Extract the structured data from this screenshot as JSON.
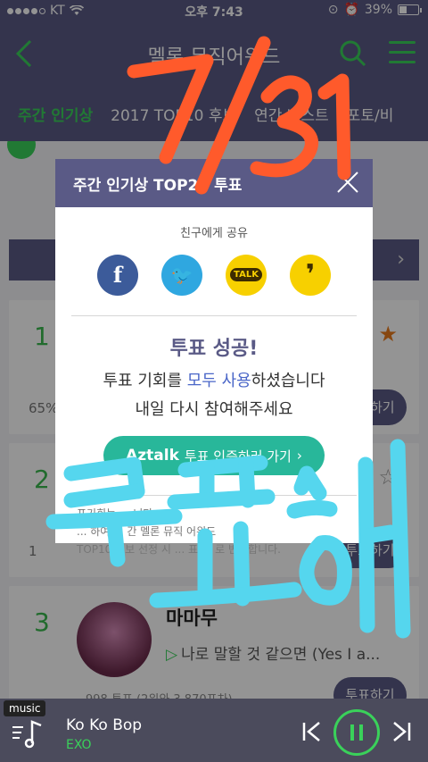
{
  "status": {
    "carrier": "KT",
    "time": "오후 7:43",
    "battery": "39%",
    "battery_level": 0.39
  },
  "header": {
    "title": "멜론 뮤직어워드",
    "back_icon": "chevron-left-icon",
    "search_icon": "search-icon",
    "menu_icon": "hamburger-menu-icon"
  },
  "tabs": [
    {
      "label": "주간 인기상",
      "active": true
    },
    {
      "label": "2017 TOP10 후보",
      "active": false
    },
    {
      "label": "연간 베스트",
      "active": false
    },
    {
      "label": "포토/비",
      "active": false
    }
  ],
  "background": {
    "rows": [
      {
        "rank": "1",
        "pct": "65%",
        "vote_label": "투표하기"
      },
      {
        "rank": "2",
        "pct": "1",
        "vote_label": "투표하기"
      },
      {
        "rank": "3",
        "artist": "마마무",
        "song": "나로 말할 것 같으면 (Yes I a...",
        "votes": "998 투표 (2위와 3,870표차)",
        "vote_label": "투표하기"
      }
    ]
  },
  "modal": {
    "title": "주간 인기상 TOP20 투표",
    "share_label": "친구에게 공유",
    "share_buttons": [
      {
        "name": "facebook",
        "glyph": "f"
      },
      {
        "name": "twitter",
        "glyph": "🐦"
      },
      {
        "name": "kakaotalk",
        "glyph": "TALK"
      },
      {
        "name": "kakaostory",
        "glyph": "❜"
      }
    ],
    "success": "투표 성공!",
    "message_line1_pre": "투표 기회를 ",
    "message_line1_hl": "모두 사용",
    "message_line1_post": "하셨습니다",
    "message_line2": "내일 다시 참여해주세요",
    "aztalk_logo": "Aztalk",
    "aztalk_label": "투표 인증하러 가기",
    "notice_line1": "표기회는 ... 니다.",
    "notice_line2": "... 하여 ... 간 멜론 뮤직 어워드",
    "notice_line3": "TOP10 후보 선정 시 ... 표 ... 로 반영합니다."
  },
  "player": {
    "tag": "music",
    "song": "Ko Ko Bop",
    "artist": "EXO"
  },
  "annotations": {
    "top": "7/31",
    "bottom": "투표해"
  },
  "colors": {
    "header_bg": "#5a5a86",
    "accent_green": "#3ad15a",
    "scribble_orange": "#ff5a2b",
    "scribble_cyan": "#55d6ee"
  }
}
